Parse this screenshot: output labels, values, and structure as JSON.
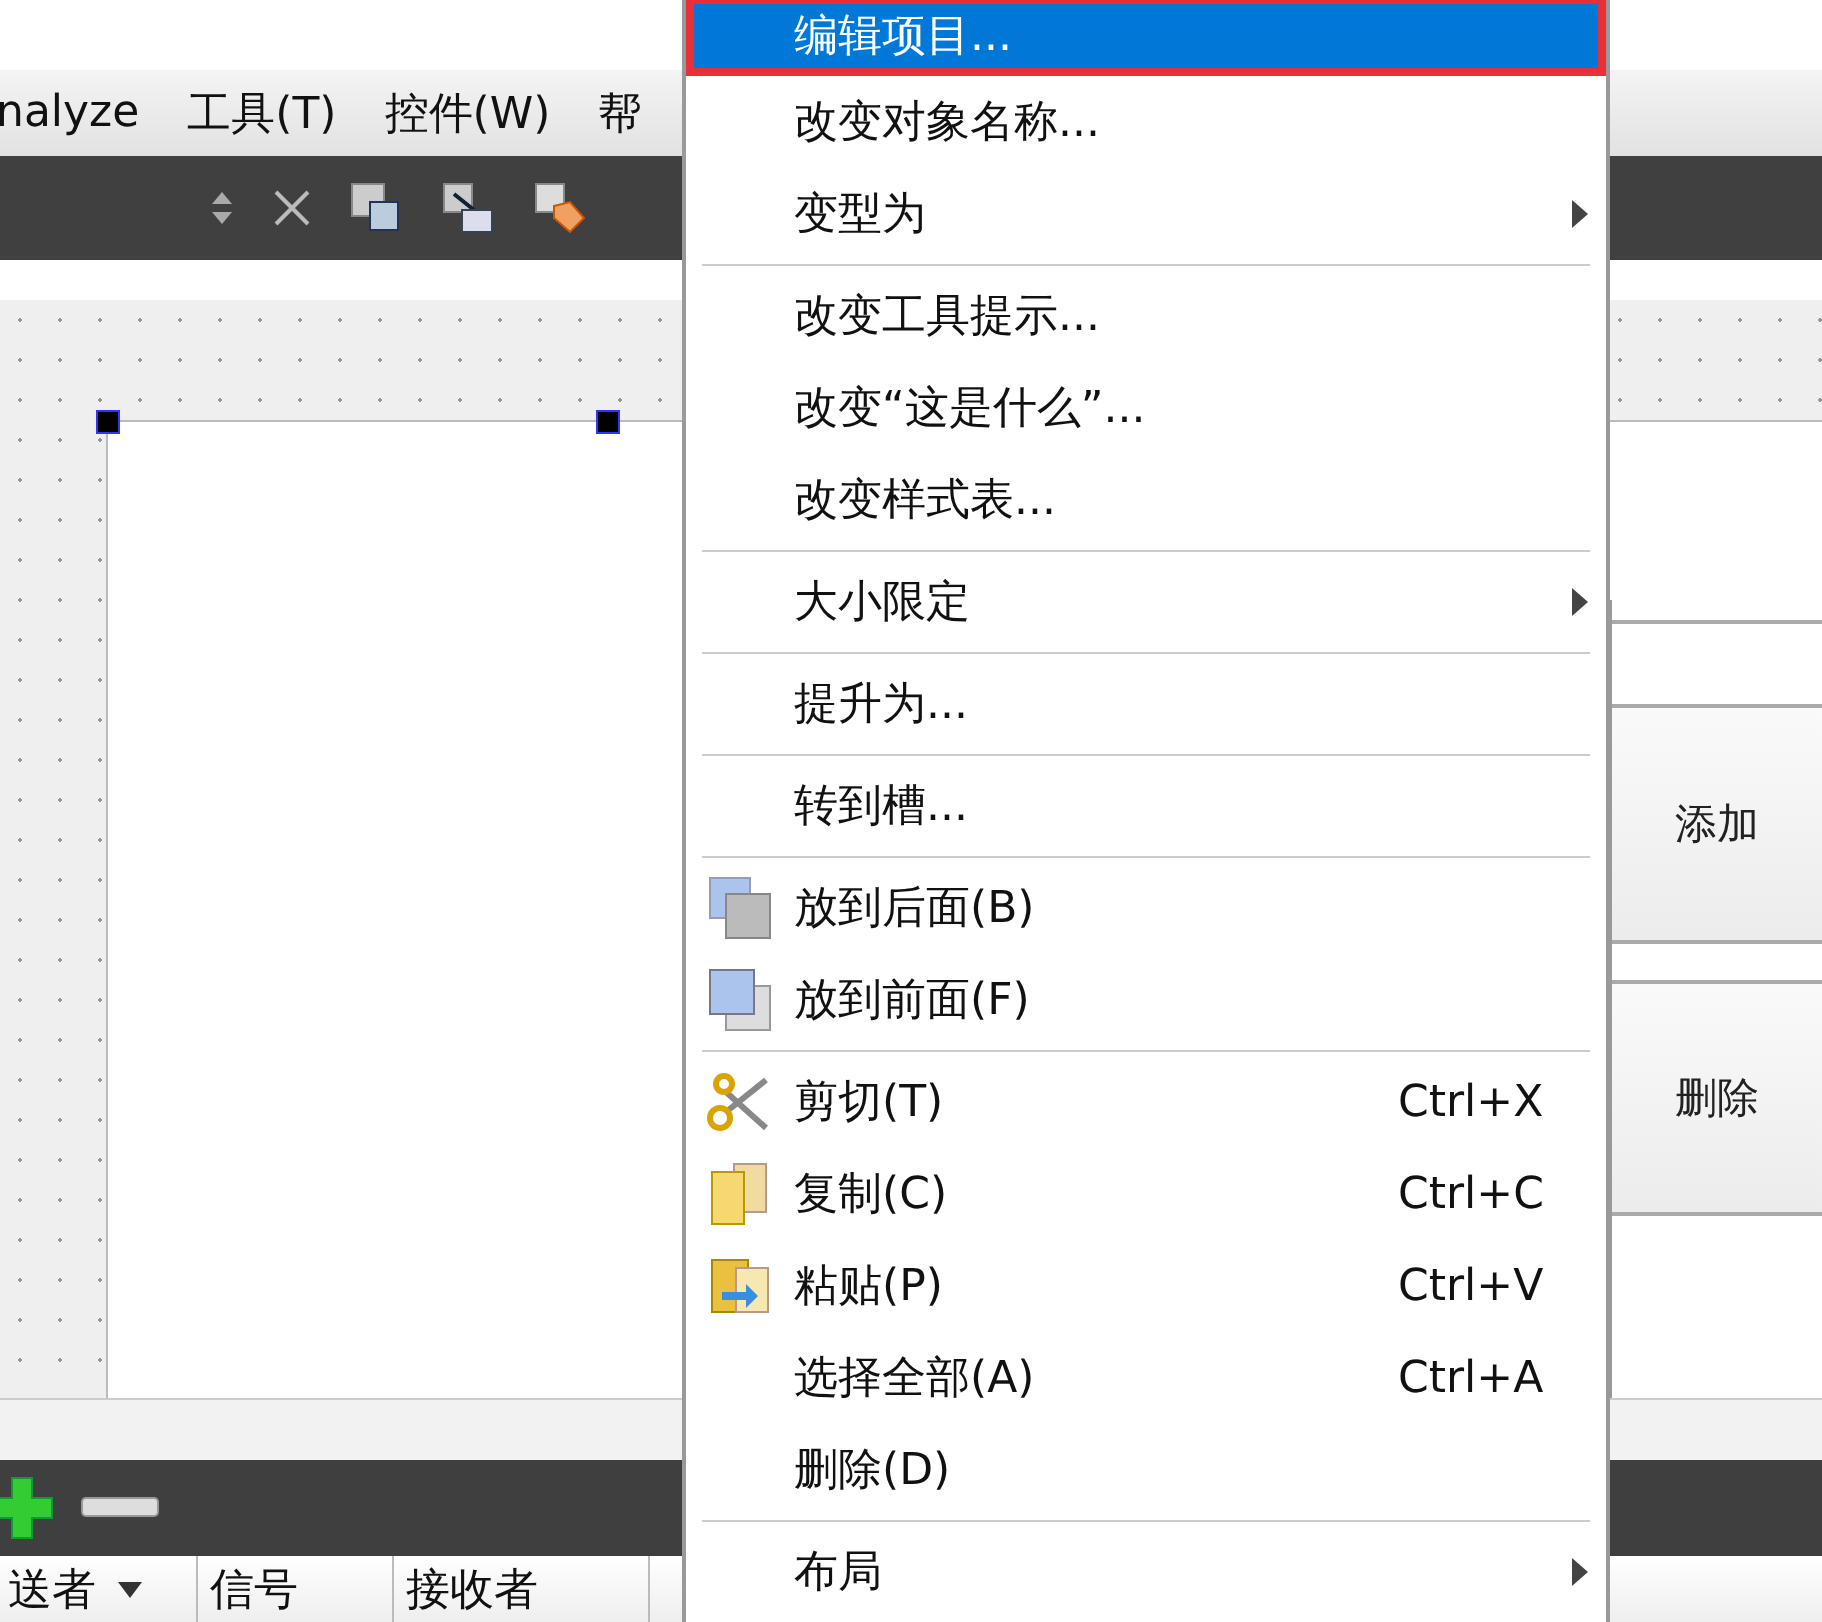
{
  "menubar": [
    "nalyze",
    "工具(T)",
    "控件(W)",
    "帮"
  ],
  "form_buttons": [
    "添加",
    "删除"
  ],
  "signal_table": {
    "columns": [
      {
        "label": "送者",
        "sortable": true
      },
      {
        "label": "信号",
        "sortable": false
      },
      {
        "label": "接收者",
        "sortable": false
      }
    ]
  },
  "context_menu": [
    {
      "kind": "item",
      "label": "编辑项目...",
      "selected": true,
      "highlighted": true
    },
    {
      "kind": "item",
      "label": "改变对象名称...",
      "selected": false
    },
    {
      "kind": "item",
      "label": "变型为",
      "selected": false,
      "submenu": true
    },
    {
      "kind": "separator"
    },
    {
      "kind": "item",
      "label": "改变工具提示...",
      "selected": false
    },
    {
      "kind": "item",
      "label": "改变“这是什么”...",
      "selected": false
    },
    {
      "kind": "item",
      "label": "改变样式表...",
      "selected": false
    },
    {
      "kind": "separator"
    },
    {
      "kind": "item",
      "label": "大小限定",
      "selected": false,
      "submenu": true
    },
    {
      "kind": "separator"
    },
    {
      "kind": "item",
      "label": "提升为...",
      "selected": false
    },
    {
      "kind": "separator"
    },
    {
      "kind": "item",
      "label": "转到槽...",
      "selected": false
    },
    {
      "kind": "separator"
    },
    {
      "kind": "item",
      "label": "放到后面(B)",
      "selected": false
    },
    {
      "kind": "item",
      "label": "放到前面(F)",
      "selected": false
    },
    {
      "kind": "separator"
    },
    {
      "kind": "item",
      "label": "剪切(T)",
      "selected": false,
      "shortcut": "Ctrl+X"
    },
    {
      "kind": "item",
      "label": "复制(C)",
      "selected": false,
      "shortcut": "Ctrl+C"
    },
    {
      "kind": "item",
      "label": "粘贴(P)",
      "selected": false,
      "shortcut": "Ctrl+V"
    },
    {
      "kind": "item",
      "label": "选择全部(A)",
      "selected": false,
      "shortcut": "Ctrl+A"
    },
    {
      "kind": "item",
      "label": "删除(D)",
      "selected": false
    },
    {
      "kind": "separator"
    },
    {
      "kind": "item",
      "label": "布局",
      "selected": false,
      "submenu": true
    }
  ]
}
